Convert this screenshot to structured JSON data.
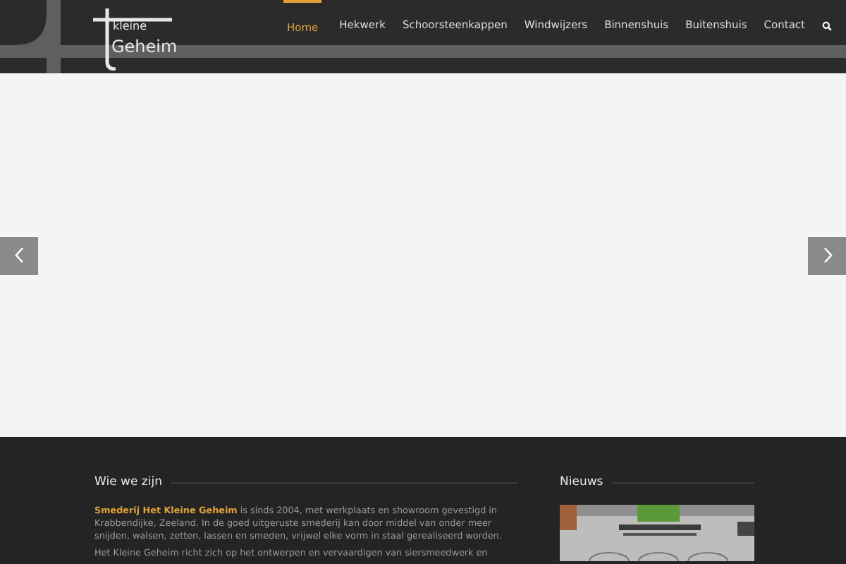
{
  "logo": {
    "word_1": "kleine",
    "word_2": "Geheim"
  },
  "nav": [
    {
      "label": "Home",
      "selected": true
    },
    {
      "label": "Hekwerk",
      "selected": false
    },
    {
      "label": "Schoorsteenkappen",
      "selected": false
    },
    {
      "label": "Windwijzers",
      "selected": false
    },
    {
      "label": "Binnenshuis",
      "selected": false
    },
    {
      "label": "Buitenshuis",
      "selected": false
    },
    {
      "label": "Contact",
      "selected": false
    }
  ],
  "about": {
    "title": "Wie we zijn",
    "lead": "**Smederij Het Kleine Geheim** is sinds 2004, met werkplaats en showroom gevestigd in Krabbendijke, Zeeland. In de goed uitgeruste smederij kan door middel van onder meer snijden, walsen, zetten, lassen en smeden, vrijwel elke vorm in staal gerealiseerd worden.",
    "next": "Het Kleine Geheim richt zich op het ontwerpen en vervaardigen van siersmeedwerk en"
  },
  "news": {
    "title": "Nieuws"
  }
}
